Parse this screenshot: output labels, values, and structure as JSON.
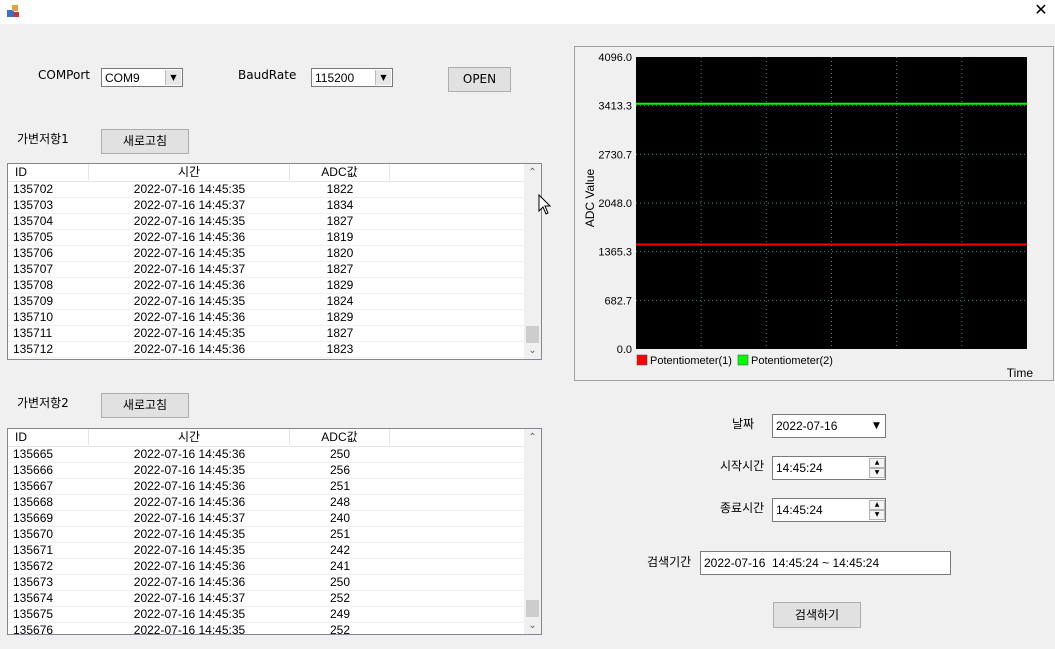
{
  "window": {
    "close_label": "✕",
    "app_icon": "app-icon"
  },
  "connection": {
    "comport_label": "COMPort",
    "comport_value": "COM9",
    "baudrate_label": "BaudRate",
    "baudrate_value": "115200",
    "open_label": "OPEN"
  },
  "panel1": {
    "title": "가변저항1",
    "refresh_label": "새로고침",
    "columns": [
      "ID",
      "시간",
      "ADC값"
    ],
    "rows": [
      [
        "135702",
        "2022-07-16 14:45:35",
        "1822"
      ],
      [
        "135703",
        "2022-07-16 14:45:37",
        "1834"
      ],
      [
        "135704",
        "2022-07-16 14:45:35",
        "1827"
      ],
      [
        "135705",
        "2022-07-16 14:45:36",
        "1819"
      ],
      [
        "135706",
        "2022-07-16 14:45:35",
        "1820"
      ],
      [
        "135707",
        "2022-07-16 14:45:37",
        "1827"
      ],
      [
        "135708",
        "2022-07-16 14:45:36",
        "1829"
      ],
      [
        "135709",
        "2022-07-16 14:45:35",
        "1824"
      ],
      [
        "135710",
        "2022-07-16 14:45:36",
        "1829"
      ],
      [
        "135711",
        "2022-07-16 14:45:35",
        "1827"
      ],
      [
        "135712",
        "2022-07-16 14:45:36",
        "1823"
      ]
    ]
  },
  "panel2": {
    "title": "가변저항2",
    "refresh_label": "새로고침",
    "columns": [
      "ID",
      "시간",
      "ADC값"
    ],
    "rows": [
      [
        "135665",
        "2022-07-16 14:45:36",
        "250"
      ],
      [
        "135666",
        "2022-07-16 14:45:35",
        "256"
      ],
      [
        "135667",
        "2022-07-16 14:45:36",
        "251"
      ],
      [
        "135668",
        "2022-07-16 14:45:36",
        "248"
      ],
      [
        "135669",
        "2022-07-16 14:45:37",
        "240"
      ],
      [
        "135670",
        "2022-07-16 14:45:35",
        "251"
      ],
      [
        "135671",
        "2022-07-16 14:45:35",
        "242"
      ],
      [
        "135672",
        "2022-07-16 14:45:36",
        "241"
      ],
      [
        "135673",
        "2022-07-16 14:45:36",
        "250"
      ],
      [
        "135674",
        "2022-07-16 14:45:37",
        "252"
      ],
      [
        "135675",
        "2022-07-16 14:45:35",
        "249"
      ],
      [
        "135676",
        "2022-07-16 14:45:35",
        "252"
      ]
    ]
  },
  "search": {
    "date_label": "날짜",
    "date_value": "2022-07-16",
    "start_label": "시작시간",
    "start_value": "14:45:24",
    "end_label": "종료시간",
    "end_value": "14:45:24",
    "period_label": "검색기간",
    "period_value": "2022-07-16  14:45:24 ~ 14:45:24",
    "search_button": "검색하기"
  },
  "chart_data": {
    "type": "line",
    "title": "",
    "xlabel": "Time",
    "ylabel": "ADC Value",
    "ylim": [
      0,
      4096
    ],
    "y_ticks": [
      "0.0",
      "682.7",
      "1365.3",
      "2048.0",
      "2730.7",
      "3413.3",
      "4096.0"
    ],
    "grid": true,
    "background": "#000000",
    "grid_color": "#2e8b8b",
    "legend_position": "bottom-left",
    "series": [
      {
        "name": "Potentiometer(1)",
        "color": "#ff0000",
        "values": [
          1465,
          1465
        ]
      },
      {
        "name": "Potentiometer(2)",
        "color": "#00ff00",
        "values": [
          3440,
          3440
        ]
      }
    ]
  }
}
